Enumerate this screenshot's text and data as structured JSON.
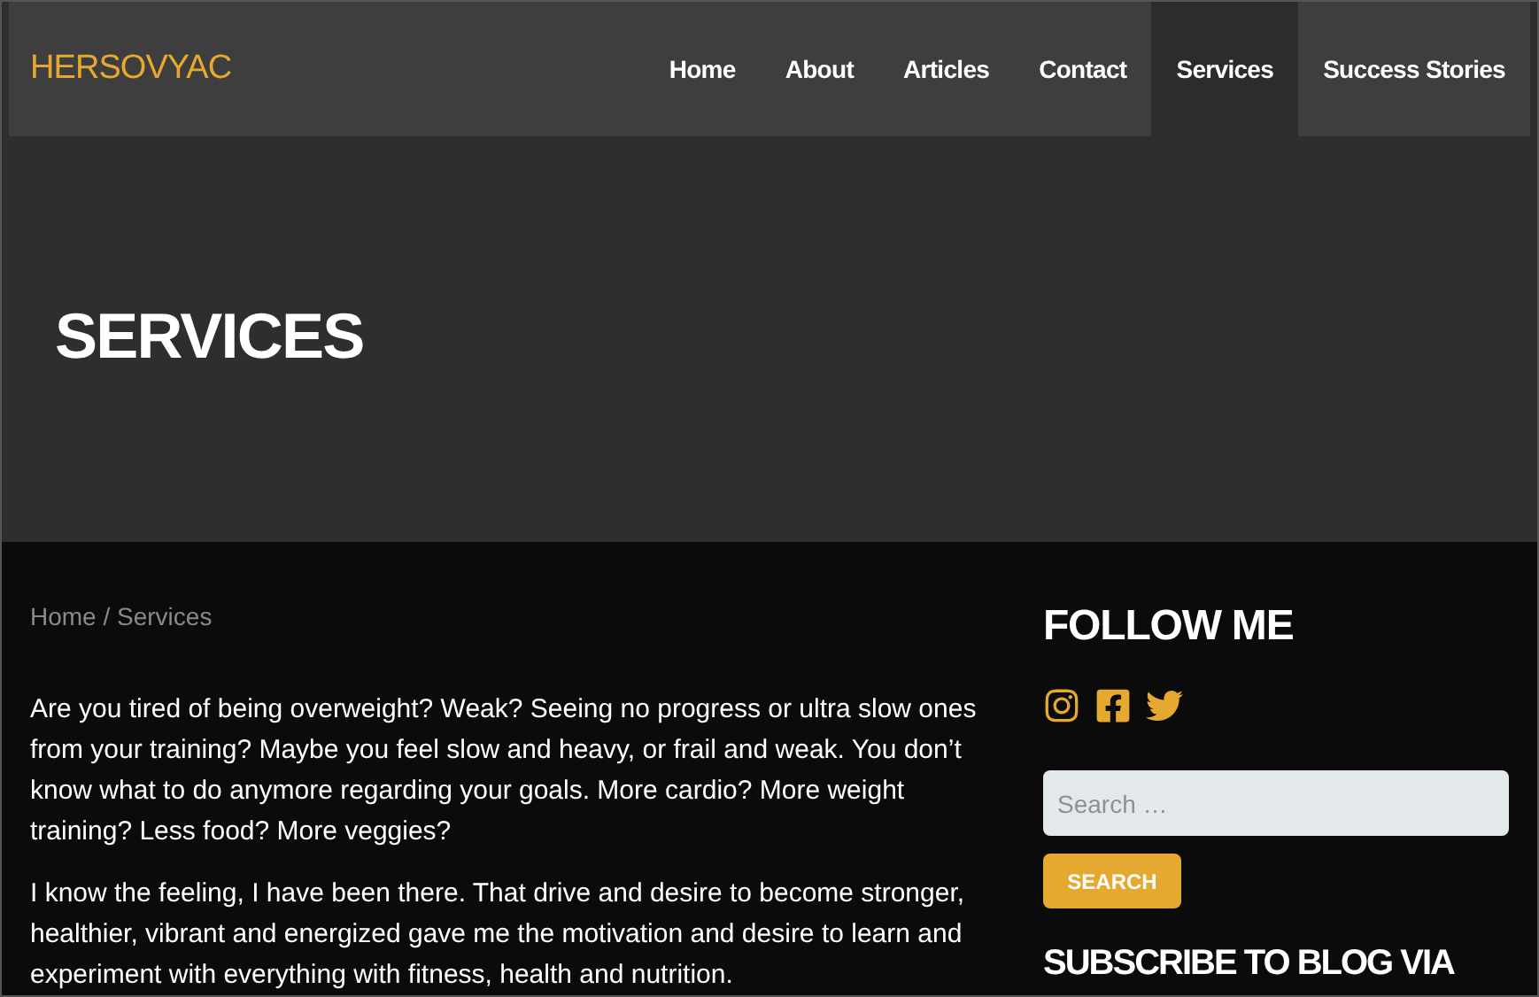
{
  "header": {
    "logo": "HERSOVYAC",
    "nav": [
      {
        "label": "Home",
        "selected": false
      },
      {
        "label": "About",
        "selected": false
      },
      {
        "label": "Articles",
        "selected": false
      },
      {
        "label": "Contact",
        "selected": false
      },
      {
        "label": "Services",
        "selected": true
      },
      {
        "label": "Success Stories",
        "selected": false
      }
    ]
  },
  "hero": {
    "title": "SERVICES"
  },
  "breadcrumb": "Home / Services",
  "paragraphs": [
    "Are you tired of being overweight? Weak? Seeing no progress or ultra slow ones from your training? Maybe you feel slow and heavy, or frail and weak. You don’t know what to do anymore regarding your goals. More cardio? More weight training? Less food? More veggies?",
    "I know the feeling, I have been there. That drive and desire to become stronger, healthier, vibrant and energized gave me the motivation and desire to learn and experiment with everything with fitness, health and nutrition."
  ],
  "sidebar": {
    "follow_title": "FOLLOW ME",
    "social": [
      {
        "kind": "instagram"
      },
      {
        "kind": "facebook"
      },
      {
        "kind": "twitter"
      }
    ],
    "search": {
      "placeholder": "Search …",
      "button": "SEARCH"
    },
    "subscribe_title": "SUBSCRIBE TO BLOG VIA"
  }
}
